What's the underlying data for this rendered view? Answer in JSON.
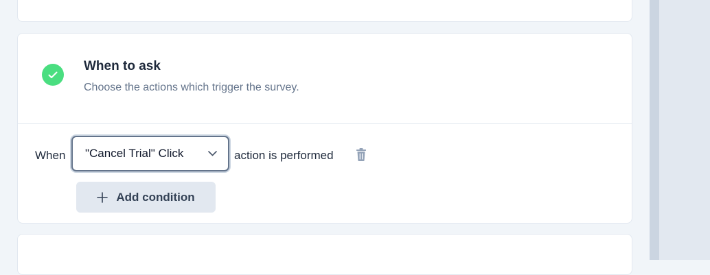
{
  "section": {
    "title": "When to ask",
    "description": "Choose the actions which trigger the survey."
  },
  "trigger": {
    "prefix": "When",
    "selected_action": "\"Cancel Trial\" Click",
    "suffix": "action is performed"
  },
  "add_condition": {
    "label": "Add condition"
  },
  "icons": {
    "status": "check-circle-icon",
    "dropdown": "chevron-down-icon",
    "delete": "trash-icon",
    "add": "plus-icon"
  },
  "colors": {
    "success": "#4ade80",
    "muted_text": "#64748b",
    "button_bg": "#e2e8f0"
  }
}
